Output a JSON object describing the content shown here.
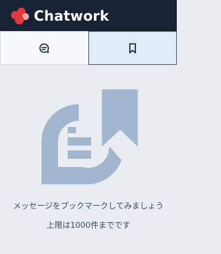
{
  "app": {
    "brand_name": "Chatwork"
  },
  "tabs": [
    {
      "name": "chat",
      "icon": "chat-bubble-icon",
      "active": false
    },
    {
      "name": "bookmark",
      "icon": "bookmark-icon",
      "active": true
    }
  ],
  "empty_state": {
    "illustration": "bookmark-message-illustration",
    "message": "メッセージをブックマークしてみましょう",
    "limit_note": "上限は1000件までです"
  },
  "colors": {
    "header_bg": "#172235",
    "page_bg": "#e9edf2",
    "active_tab_bg": "#e1ecf8",
    "illustration": "#a3b6cf",
    "logo_red": "#e8383d",
    "logo_pink": "#f5a3a6"
  }
}
